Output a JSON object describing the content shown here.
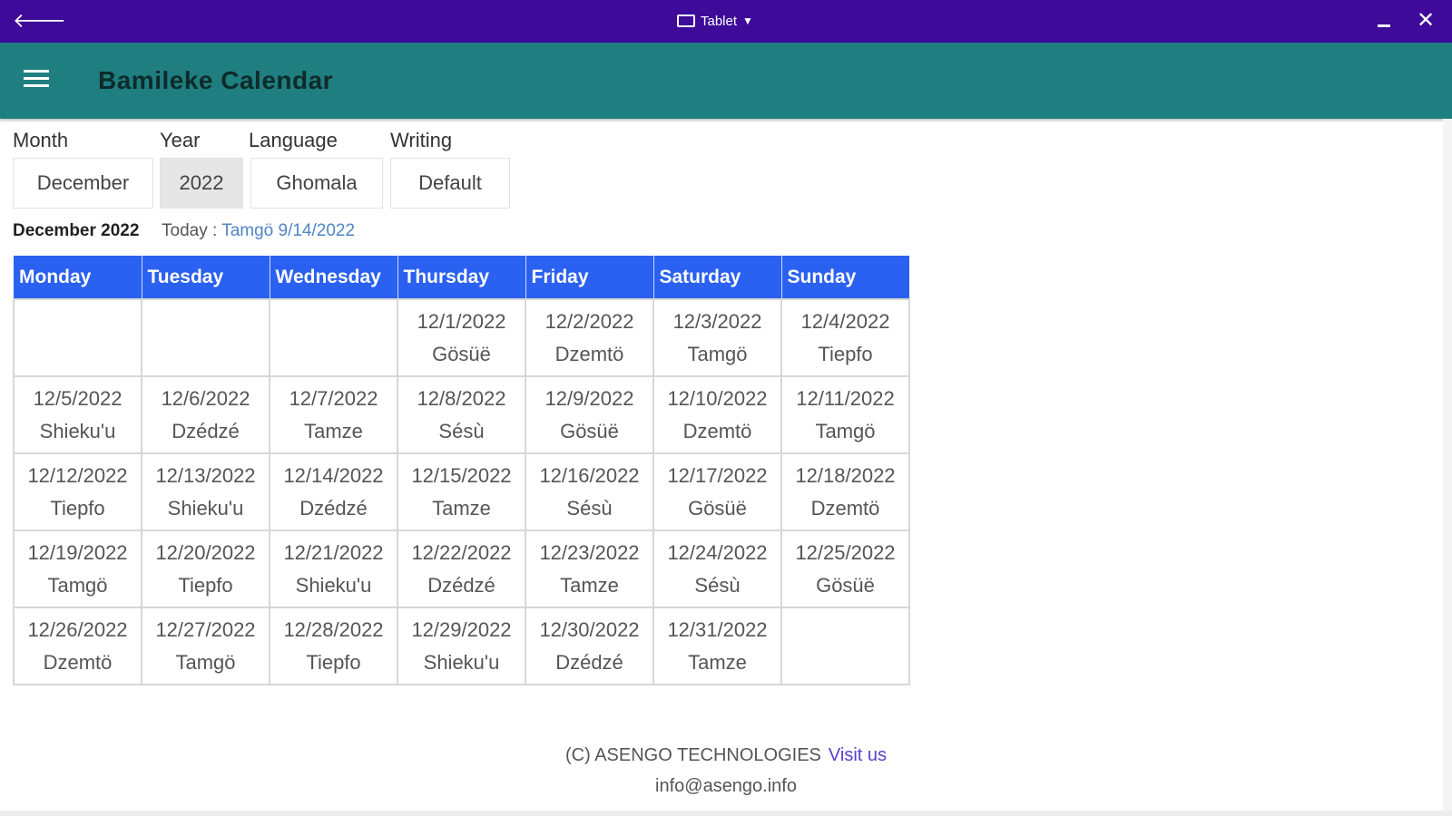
{
  "window": {
    "mode_label": "Tablet",
    "back_glyph": "🡐",
    "close_glyph": "✕",
    "caret_glyph": "▼"
  },
  "appbar": {
    "title": "Bamileke Calendar"
  },
  "controls": {
    "month": {
      "label": "Month",
      "value": "December"
    },
    "year": {
      "label": "Year",
      "value": "2022"
    },
    "language": {
      "label": "Language",
      "value": "Ghomala"
    },
    "writing": {
      "label": "Writing",
      "value": "Default"
    }
  },
  "summary": {
    "heading": "December 2022",
    "today_label": "Today : ",
    "today_value": "Tamgö 9/14/2022"
  },
  "calendar": {
    "header_color": "#2b61f0",
    "days": [
      "Monday",
      "Tuesday",
      "Wednesday",
      "Thursday",
      "Friday",
      "Saturday",
      "Sunday"
    ],
    "weeks": [
      [
        {
          "date": "",
          "name": ""
        },
        {
          "date": "",
          "name": ""
        },
        {
          "date": "",
          "name": ""
        },
        {
          "date": "12/1/2022",
          "name": "Gösüë"
        },
        {
          "date": "12/2/2022",
          "name": "Dzemtö"
        },
        {
          "date": "12/3/2022",
          "name": "Tamgö"
        },
        {
          "date": "12/4/2022",
          "name": "Tiepfo"
        }
      ],
      [
        {
          "date": "12/5/2022",
          "name": "Shieku'u"
        },
        {
          "date": "12/6/2022",
          "name": "Dzédzé"
        },
        {
          "date": "12/7/2022",
          "name": "Tamze"
        },
        {
          "date": "12/8/2022",
          "name": "Sésù"
        },
        {
          "date": "12/9/2022",
          "name": "Gösüë"
        },
        {
          "date": "12/10/2022",
          "name": "Dzemtö"
        },
        {
          "date": "12/11/2022",
          "name": "Tamgö"
        }
      ],
      [
        {
          "date": "12/12/2022",
          "name": "Tiepfo"
        },
        {
          "date": "12/13/2022",
          "name": "Shieku'u"
        },
        {
          "date": "12/14/2022",
          "name": "Dzédzé"
        },
        {
          "date": "12/15/2022",
          "name": "Tamze"
        },
        {
          "date": "12/16/2022",
          "name": "Sésù"
        },
        {
          "date": "12/17/2022",
          "name": "Gösüë"
        },
        {
          "date": "12/18/2022",
          "name": "Dzemtö"
        }
      ],
      [
        {
          "date": "12/19/2022",
          "name": "Tamgö"
        },
        {
          "date": "12/20/2022",
          "name": "Tiepfo"
        },
        {
          "date": "12/21/2022",
          "name": "Shieku'u"
        },
        {
          "date": "12/22/2022",
          "name": "Dzédzé"
        },
        {
          "date": "12/23/2022",
          "name": "Tamze"
        },
        {
          "date": "12/24/2022",
          "name": "Sésù"
        },
        {
          "date": "12/25/2022",
          "name": "Gösüë"
        }
      ],
      [
        {
          "date": "12/26/2022",
          "name": "Dzemtö"
        },
        {
          "date": "12/27/2022",
          "name": "Tamgö"
        },
        {
          "date": "12/28/2022",
          "name": "Tiepfo"
        },
        {
          "date": "12/29/2022",
          "name": "Shieku'u"
        },
        {
          "date": "12/30/2022",
          "name": "Dzédzé"
        },
        {
          "date": "12/31/2022",
          "name": "Tamze"
        },
        {
          "date": "",
          "name": ""
        }
      ]
    ]
  },
  "footer": {
    "copyright": "(C) ASENGO TECHNOLOGIES",
    "visit_label": "Visit us",
    "email": "info@asengo.info"
  },
  "colors": {
    "titlebar": "#3d0a9a",
    "appbar": "#1f7f80",
    "link": "#4f86c6",
    "header": "#2b61f0"
  }
}
